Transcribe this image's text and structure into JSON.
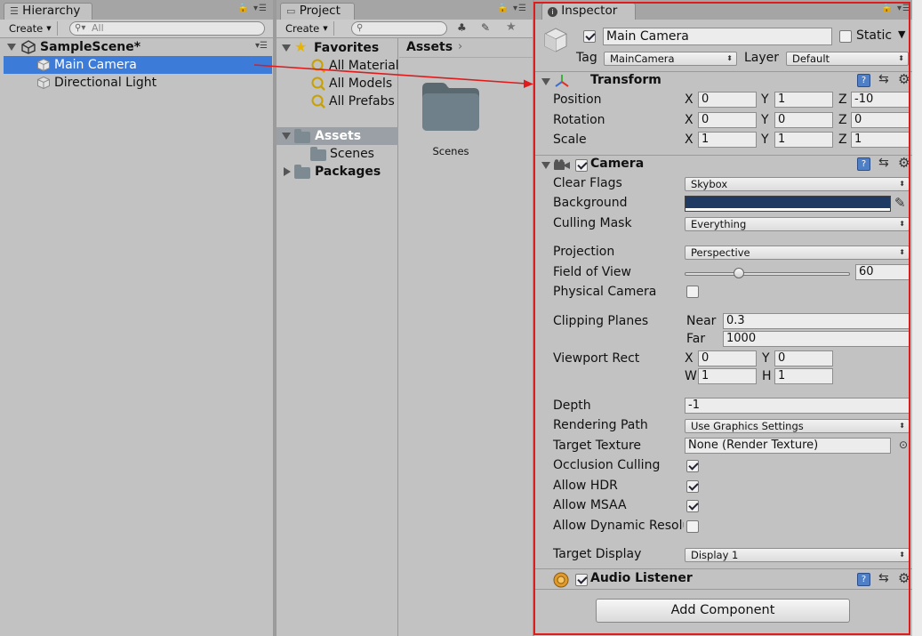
{
  "hierarchy": {
    "tab_label": "Hierarchy",
    "create_label": "Create",
    "search_placeholder": "All",
    "scene_name": "SampleScene*",
    "items": [
      {
        "label": "Main Camera"
      },
      {
        "label": "Directional Light"
      }
    ]
  },
  "project": {
    "tab_label": "Project",
    "create_label": "Create",
    "favorites_label": "Favorites",
    "favorites": [
      "All Materials",
      "All Models",
      "All Prefabs"
    ],
    "assets_tree_label": "Assets",
    "assets_children": [
      "Scenes"
    ],
    "packages_label": "Packages",
    "breadcrumb": "Assets",
    "grid_items": [
      {
        "label": "Scenes"
      }
    ]
  },
  "inspector": {
    "tab_label": "Inspector",
    "object_name": "Main Camera",
    "static_label": "Static",
    "tag_label": "Tag",
    "tag_value": "MainCamera",
    "layer_label": "Layer",
    "layer_value": "Default",
    "transform": {
      "title": "Transform",
      "position_label": "Position",
      "rotation_label": "Rotation",
      "scale_label": "Scale",
      "axis_x": "X",
      "axis_y": "Y",
      "axis_z": "Z",
      "position": {
        "x": "0",
        "y": "1",
        "z": "-10"
      },
      "rotation": {
        "x": "0",
        "y": "0",
        "z": "0"
      },
      "scale": {
        "x": "1",
        "y": "1",
        "z": "1"
      }
    },
    "camera": {
      "title": "Camera",
      "clear_flags_label": "Clear Flags",
      "clear_flags_value": "Skybox",
      "background_label": "Background",
      "background_color": "#1f3a63",
      "culling_mask_label": "Culling Mask",
      "culling_mask_value": "Everything",
      "projection_label": "Projection",
      "projection_value": "Perspective",
      "fov_label": "Field of View",
      "fov_value": "60",
      "fov_fraction": 0.33,
      "physical_camera_label": "Physical Camera",
      "clipping_label": "Clipping Planes",
      "near_label": "Near",
      "near_value": "0.3",
      "far_label": "Far",
      "far_value": "1000",
      "viewport_label": "Viewport Rect",
      "vp_x_label": "X",
      "vp_y_label": "Y",
      "vp_w_label": "W",
      "vp_h_label": "H",
      "vp_x": "0",
      "vp_y": "0",
      "vp_w": "1",
      "vp_h": "1",
      "depth_label": "Depth",
      "depth_value": "-1",
      "rendering_path_label": "Rendering Path",
      "rendering_path_value": "Use Graphics Settings",
      "target_texture_label": "Target Texture",
      "target_texture_value": "None (Render Texture)",
      "occlusion_label": "Occlusion Culling",
      "hdr_label": "Allow HDR",
      "msaa_label": "Allow MSAA",
      "dynres_label": "Allow Dynamic Resolu",
      "target_display_label": "Target Display",
      "target_display_value": "Display 1"
    },
    "audio_listener": {
      "title": "Audio Listener"
    },
    "add_component_label": "Add Component"
  },
  "colors": {
    "selection": "#3d7bd9",
    "highlight_box": "#e01b1b",
    "panel_bg": "#c2c2c2"
  }
}
